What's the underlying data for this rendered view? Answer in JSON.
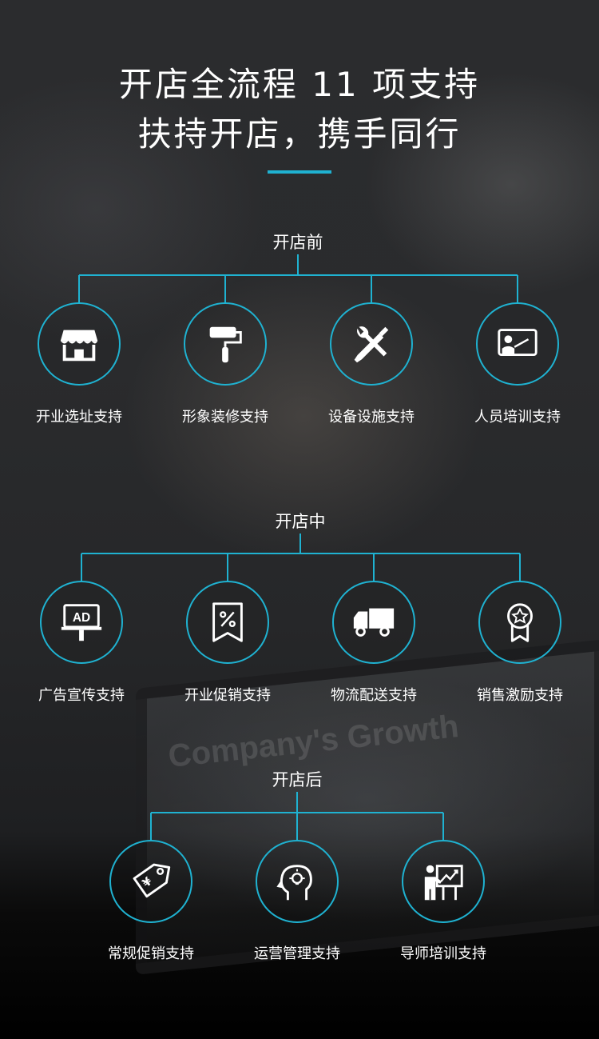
{
  "header": {
    "title_line1": "开店全流程 11 项支持",
    "title_line2": "扶持开店，携手同行"
  },
  "background": {
    "laptop_text": "Company's Growth"
  },
  "accent_color": "#1fb2d1",
  "sections": [
    {
      "label": "开店前",
      "items": [
        {
          "label": "开业选址支持",
          "icon": "storefront-icon"
        },
        {
          "label": "形象装修支持",
          "icon": "paint-roller-icon"
        },
        {
          "label": "设备设施支持",
          "icon": "wrench-screwdriver-icon"
        },
        {
          "label": "人员培训支持",
          "icon": "presentation-board-icon"
        }
      ]
    },
    {
      "label": "开店中",
      "items": [
        {
          "label": "广告宣传支持",
          "icon": "ad-billboard-icon"
        },
        {
          "label": "开业促销支持",
          "icon": "discount-tag-icon"
        },
        {
          "label": "物流配送支持",
          "icon": "delivery-truck-icon"
        },
        {
          "label": "销售激励支持",
          "icon": "award-badge-icon"
        }
      ]
    },
    {
      "label": "开店后",
      "items": [
        {
          "label": "常规促销支持",
          "icon": "price-tag-icon"
        },
        {
          "label": "运营管理支持",
          "icon": "head-lightbulb-icon"
        },
        {
          "label": "导师培训支持",
          "icon": "mentor-chart-icon"
        }
      ]
    }
  ]
}
